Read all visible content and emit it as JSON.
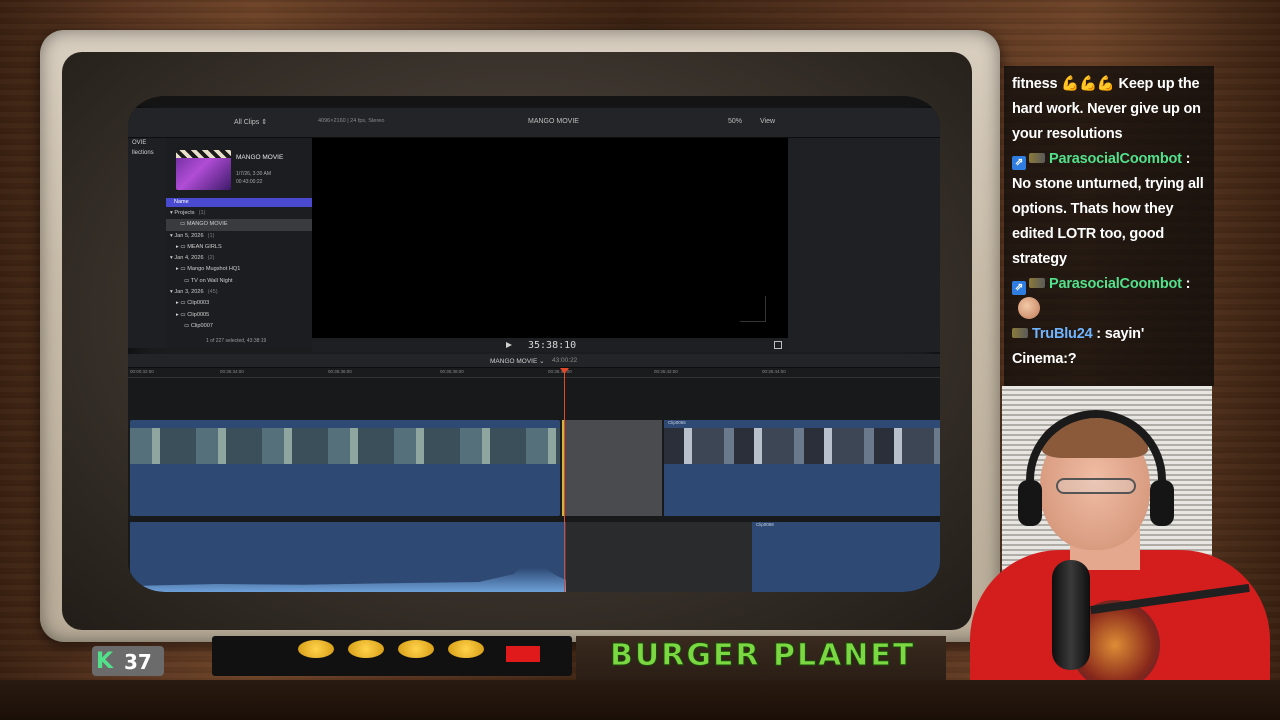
{
  "library": {
    "items": [
      "OVIE",
      "llections"
    ]
  },
  "browser_bar": {
    "filter": "All Clips ⇕",
    "format": "4096×2160 | 24 fps, Stereo",
    "project_title": "MANGO MOVIE",
    "zoom": "50%",
    "view": "View"
  },
  "browser": {
    "thumb_title": "MANGO MOVIE",
    "thumb_date": "1/7/26, 3:30 AM",
    "thumb_duration": "00:43:00:22",
    "column_name": "Name",
    "rows": [
      {
        "label": "Projects",
        "count": "(1)"
      },
      {
        "label": "MANGO MOVIE",
        "count": ""
      },
      {
        "label": "Jan 5, 2026",
        "count": "(1)"
      },
      {
        "label": "MEAN GIRLS",
        "count": ""
      },
      {
        "label": "Jan 4, 2026",
        "count": "(2)"
      },
      {
        "label": "Mango Mugshot HQ1",
        "count": ""
      },
      {
        "label": "TV on Wall Night",
        "count": ""
      },
      {
        "label": "Jan 3, 2026",
        "count": "(45)"
      },
      {
        "label": "Clip0003",
        "count": ""
      },
      {
        "label": "Clip0005",
        "count": ""
      },
      {
        "label": "Clip0007",
        "count": ""
      }
    ],
    "footer": "1 of 227 selected, 43:38:19"
  },
  "viewer": {
    "timecode": "35:38:10"
  },
  "timeline": {
    "title": "MANGO MOVIE ⌄",
    "duration": "43:00:22",
    "ruler_ticks": [
      "00:00:32:00",
      "00:35:34:00",
      "00:35:36:00",
      "00:35:38:00",
      "00:35:40:00",
      "00:35:42:00",
      "00:35:44:00"
    ],
    "clip_b_label": "Clip0055",
    "audio_b_label": "Clip0058"
  },
  "chat": {
    "messages": [
      {
        "text": "fitness 💪💪💪 Keep up the hard work. Never give up on your resolutions"
      },
      {
        "user": "ParasocialCoombot",
        "text": ": No stone unturned, trying all options. Thats how they edited LOTR too, good strategy"
      },
      {
        "user": "ParasocialCoombot",
        "text": ":"
      },
      {
        "user": "TruBlu24",
        "text": ": sayin' Cinema:?"
      }
    ]
  },
  "bottom": {
    "k_count": "37",
    "brand": "BURGER PLANET"
  },
  "colors": {
    "chat_username": "#53e08b",
    "chat_username_blue": "#6fb4ff",
    "timeline_clip": "#2e4a74",
    "playhead": "#e04a2a",
    "brand_text": "#7bd842"
  }
}
